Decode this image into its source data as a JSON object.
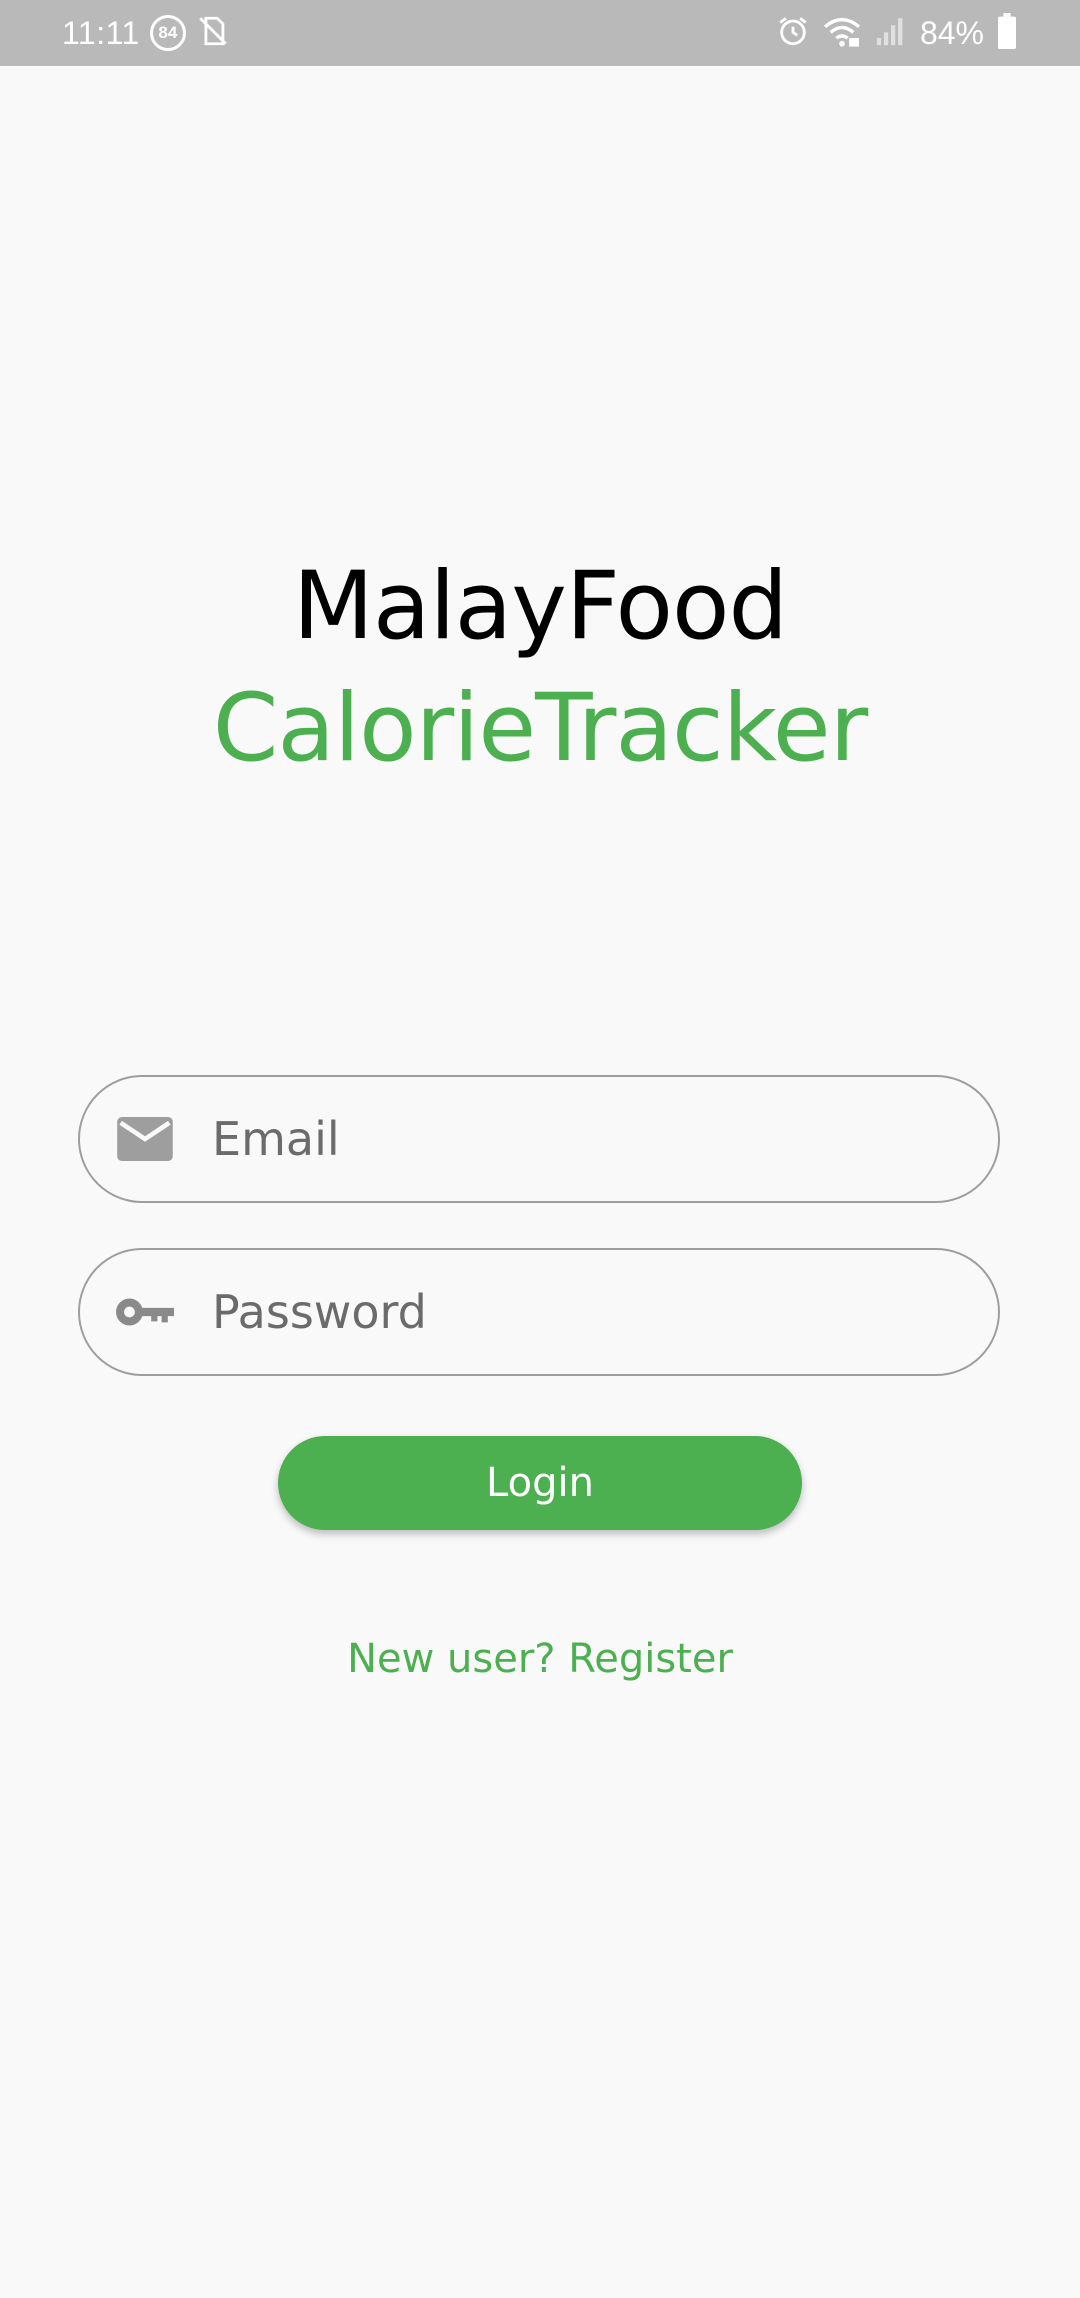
{
  "status_bar": {
    "time": "11:11",
    "notification_badge": "84",
    "battery_percent": "84%",
    "icons": [
      "no-sim-icon",
      "alarm-icon",
      "wifi-icon",
      "signal-icon",
      "battery-icon"
    ]
  },
  "app": {
    "title_line1": "MalayFood",
    "title_line2": "CalorieTracker"
  },
  "form": {
    "email": {
      "value": "",
      "placeholder": "Email",
      "icon": "mail-icon"
    },
    "password": {
      "value": "",
      "placeholder": "Password",
      "icon": "key-icon"
    },
    "login_label": "Login",
    "register_label": "New user? Register"
  },
  "colors": {
    "accent": "#4caf50",
    "status_bar": "#b9b9b9",
    "background": "#f9f9fa"
  }
}
